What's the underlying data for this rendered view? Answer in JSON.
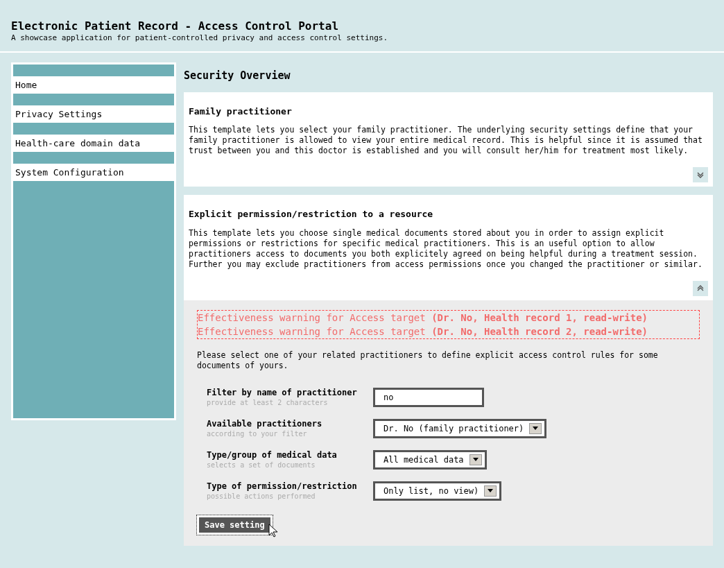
{
  "header": {
    "title": "Electronic Patient Record - Access Control Portal",
    "subtitle": "A showcase application for patient-controlled privacy and access control settings."
  },
  "sidebar": {
    "items": [
      {
        "label": "Home"
      },
      {
        "label": "Privacy Settings"
      },
      {
        "label": "Health-care domain data"
      },
      {
        "label": "System Configuration"
      }
    ]
  },
  "page_title": "Security Overview",
  "templates": [
    {
      "title": "Family practitioner",
      "description": "This template lets you select your family practitioner. The underlying security settings define that your family practitioner is allowed to view your entire medical record. This is helpful since it is assumed that trust between you and this doctor is established and you will consult her/him for treatment most likely.",
      "expanded": false
    },
    {
      "title": "Explicit permission/restriction to a resource",
      "description": "This template lets you choose single medical documents stored about you in order to assign explicit permissions or restrictions for specific medical practitioners. This is an useful option to allow practitioners access to documents you both explicitely agreed on being helpful during a treatment session. Further you may exclude practitioners from access permissions once you changed the practitioner or similar.",
      "expanded": true
    }
  ],
  "form": {
    "warnings": [
      "Effectiveness warning for Access target **(Dr. No, Health record 1, read-write)**",
      "Effectiveness warning for Access target **(Dr. No, Health record 2, read-write)**"
    ],
    "intro": "Please select one of your related practitioners to define explicit access control rules for some documents of yours.",
    "fields": [
      {
        "kind": "text",
        "label": "Filter by name of practitioner",
        "hint": "provide at least 2 characters",
        "value": "no"
      },
      {
        "kind": "select",
        "label": "Available practitioners",
        "hint": "according to your filter",
        "value": "Dr. No (family practitioner)"
      },
      {
        "kind": "select",
        "label": "Type/group of medical data",
        "hint": "selects a set of documents",
        "value": "All medical data"
      },
      {
        "kind": "select",
        "label": "Type of permission/restriction",
        "hint": "possible actions performed",
        "value": "Only list, no view)"
      }
    ],
    "save_button": "Save setting"
  }
}
